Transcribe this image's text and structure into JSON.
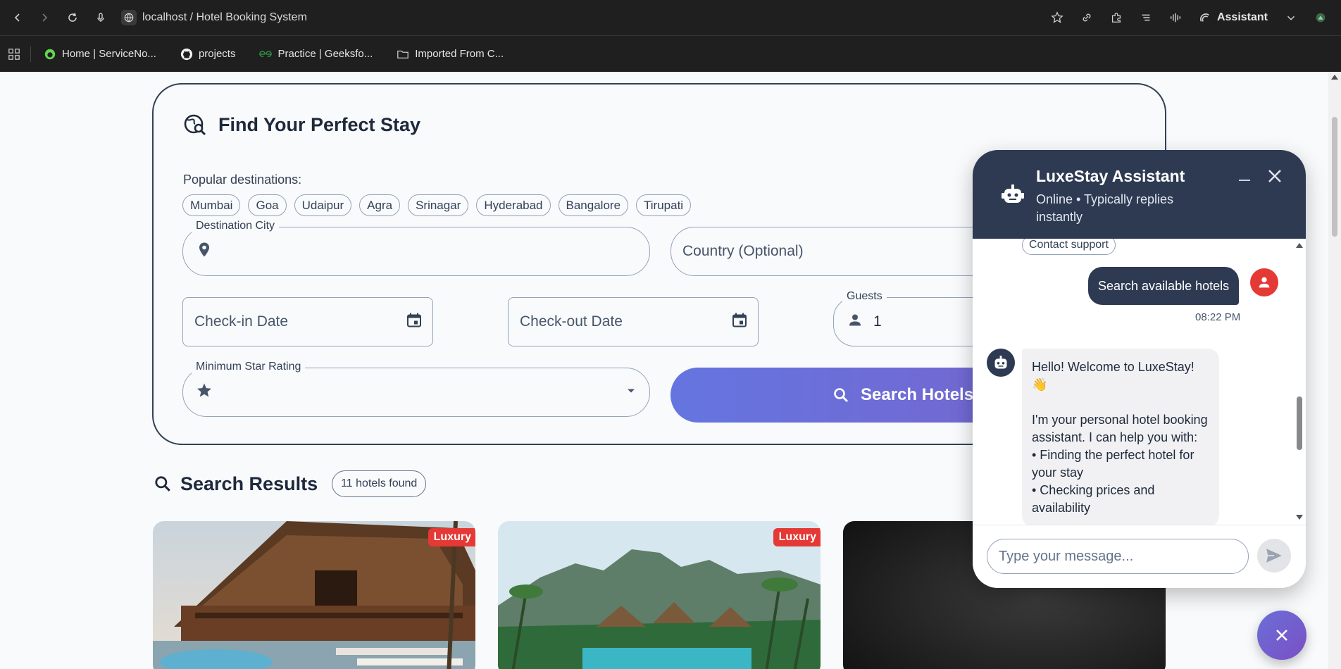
{
  "browser": {
    "address": "localhost / Hotel Booking System",
    "assistant_label": "Assistant",
    "bookmarks": [
      {
        "label": "Home | ServiceNo...",
        "icon": "servicenow-icon"
      },
      {
        "label": "projects",
        "icon": "github-icon"
      },
      {
        "label": "Practice | Geeksfo...",
        "icon": "geeksforgeeks-icon"
      },
      {
        "label": "Imported From C...",
        "icon": "folder-icon"
      }
    ]
  },
  "search": {
    "title": "Find Your Perfect Stay",
    "popular_label": "Popular destinations:",
    "destinations": [
      "Mumbai",
      "Goa",
      "Udaipur",
      "Agra",
      "Srinagar",
      "Hyderabad",
      "Bangalore",
      "Tirupati"
    ],
    "destination_label": "Destination City",
    "destination_value": "",
    "country_placeholder": "Country (Optional)",
    "checkin_placeholder": "Check-in Date",
    "checkout_placeholder": "Check-out Date",
    "guests_label": "Guests",
    "guests_value": "1",
    "rating_label": "Minimum Star Rating",
    "search_button": "Search Hotels"
  },
  "results": {
    "title": "Search Results",
    "count": "11 hotels found",
    "cards": [
      {
        "badge": "Luxury"
      },
      {
        "badge": "Luxury"
      },
      {
        "badge": ""
      }
    ]
  },
  "chat": {
    "title": "LuxeStay Assistant",
    "subtitle": "Online • Typically replies instantly",
    "contact_chip": "Contact support",
    "user_message": "Search available hotels",
    "time": "08:22 PM",
    "bot_message": "Hello! Welcome to LuxeStay! 👋\n\nI'm your personal hotel booking assistant. I can help you with:\n• Finding the perfect hotel for your stay\n• Checking prices and availability",
    "input_placeholder": "Type your message..."
  },
  "colors": {
    "header": "#2d3a52",
    "accent_start": "#6575e0",
    "accent_end": "#7a61c9",
    "badge": "#e53935"
  }
}
